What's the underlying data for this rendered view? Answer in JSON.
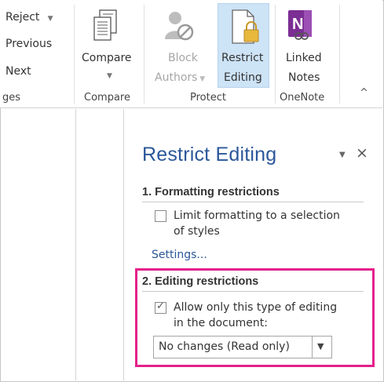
{
  "ribbon": {
    "review_group": {
      "reject_label": "Reject",
      "previous_label": "Previous",
      "next_label": "Next",
      "group_label": "ges"
    },
    "compare_group": {
      "compare_label": "Compare",
      "group_label": "Compare"
    },
    "protect_group": {
      "block_label_1": "Block",
      "block_label_2": "Authors",
      "restrict_label_1": "Restrict",
      "restrict_label_2": "Editing",
      "group_label": "Protect"
    },
    "onenote_group": {
      "linked_label_1": "Linked",
      "linked_label_2": "Notes",
      "group_label": "OneNote"
    },
    "collapse_glyph": "^"
  },
  "task_pane": {
    "title": "Restrict Editing",
    "menu_glyph": "▼",
    "close_glyph": "×",
    "section1": {
      "heading": "1. Formatting restrictions",
      "checkbox_line1": "Limit formatting to a selection",
      "checkbox_line2": "of styles",
      "checked": false,
      "settings_link": "Settings..."
    },
    "section2": {
      "heading": "2. Editing restrictions",
      "checkbox_line1": "Allow only this type of editing",
      "checkbox_line2": "in the document:",
      "checked": true,
      "dropdown_value": "No changes (Read only)"
    }
  },
  "colors": {
    "accent_blue": "#2b579a",
    "highlight_magenta": "#e4208b",
    "selected_button_bg": "#cde3f6",
    "onenote_purple": "#7b2e93"
  }
}
